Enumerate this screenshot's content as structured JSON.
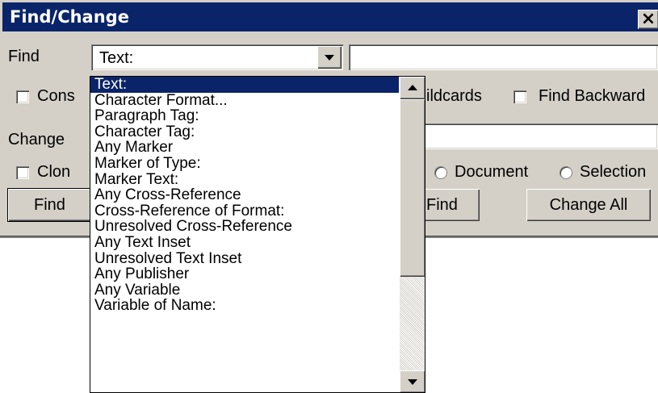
{
  "window": {
    "title": "Find/Change",
    "close_glyph": "×"
  },
  "find": {
    "label": "Find",
    "type_value": "Text:",
    "text_value": ""
  },
  "options": {
    "consider_case_label": "Cons",
    "wildcards_label": "ildcards",
    "find_backward_label": "Find Backward"
  },
  "change": {
    "label": "Change",
    "text_value": ""
  },
  "clone": {
    "clone_label": "Clon",
    "document_label": "Document",
    "selection_label": "Selection"
  },
  "buttons": {
    "find_label": "Find",
    "change_and_find_label": "Find",
    "change_all_label": "Change All"
  },
  "dropdown": {
    "items": [
      "Text:",
      "Character Format...",
      "Paragraph Tag:",
      "Character Tag:",
      "Any Marker",
      "Marker of Type:",
      "Marker Text:",
      "Any Cross-Reference",
      "Cross-Reference of Format:",
      "Unresolved Cross-Reference",
      "Any Text Inset",
      "Unresolved Text Inset",
      "Any Publisher",
      "Any Variable",
      "Variable of Name:"
    ],
    "selected_index": 0
  },
  "colors": {
    "titlebar": "#0a246a",
    "face": "#d4d0c8",
    "selection": "#0a246a"
  }
}
